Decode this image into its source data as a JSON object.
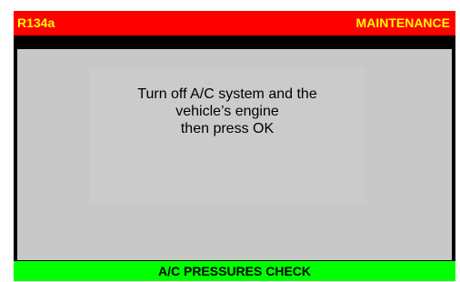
{
  "header": {
    "refrigerant": "R134a",
    "mode": "MAINTENANCE"
  },
  "message": {
    "lines": [
      "Turn off A/C system and the",
      "vehicle’s engine",
      "then press OK"
    ]
  },
  "footer": {
    "title": "A/C PRESSURES CHECK"
  },
  "colors": {
    "header_bg": "#ff0000",
    "header_text": "#ffff00",
    "content_bg": "#c8c8c8",
    "footer_bg": "#00ff00",
    "frame": "#000000"
  }
}
